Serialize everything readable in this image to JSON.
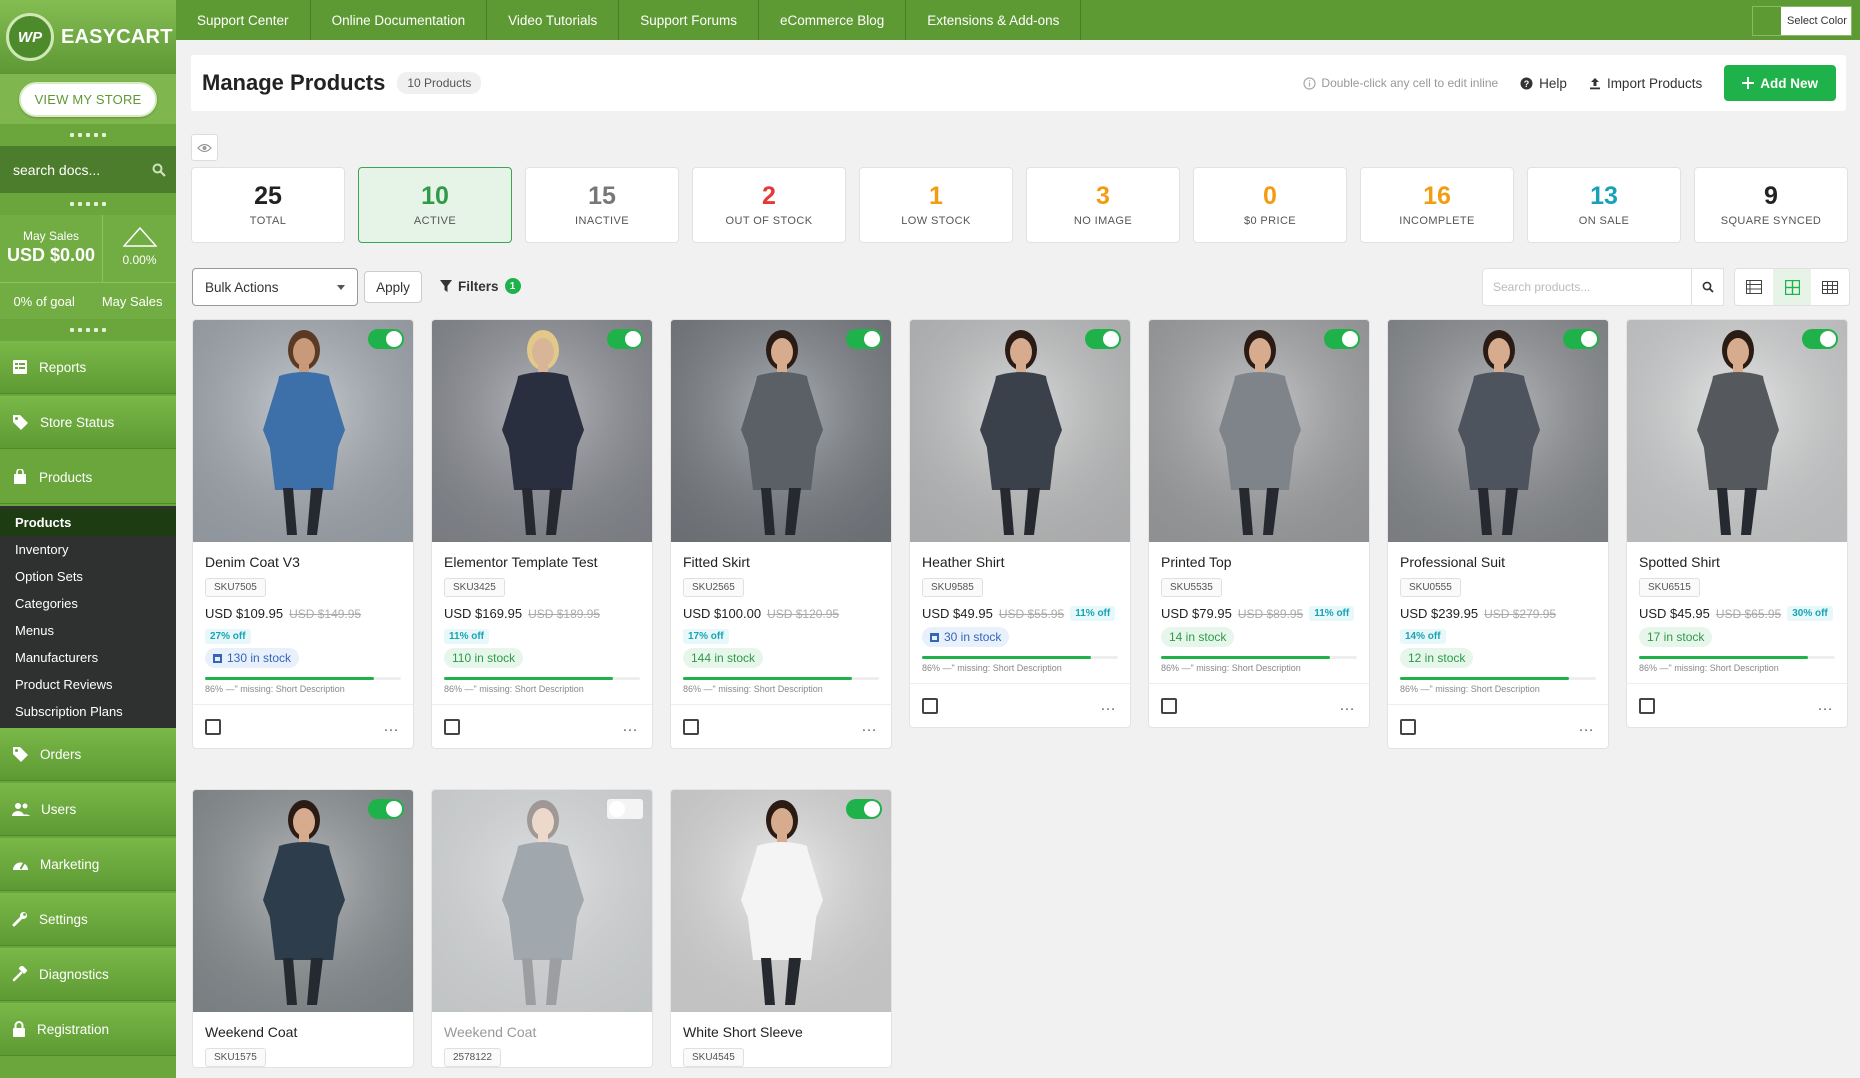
{
  "app": {
    "logo_mark": "WP",
    "name": "EASYCART",
    "view_store": "VIEW MY STORE",
    "search_placeholder": "search docs..."
  },
  "sales": {
    "label": "May Sales",
    "amount": "USD $0.00",
    "change": "0.00%",
    "goal": "0% of goal",
    "period": "May Sales"
  },
  "nav": [
    {
      "label": "Reports",
      "icon": "report-icon"
    },
    {
      "label": "Store Status",
      "icon": "tag-icon"
    },
    {
      "label": "Products",
      "icon": "bag-icon"
    }
  ],
  "sub_nav": [
    "Products",
    "Inventory",
    "Option Sets",
    "Categories",
    "Menus",
    "Manufacturers",
    "Product Reviews",
    "Subscription Plans"
  ],
  "nav2": [
    {
      "label": "Orders",
      "icon": "tag-icon"
    },
    {
      "label": "Users",
      "icon": "users-icon"
    },
    {
      "label": "Marketing",
      "icon": "gauge-icon"
    },
    {
      "label": "Settings",
      "icon": "wrench-icon"
    },
    {
      "label": "Diagnostics",
      "icon": "hammer-icon"
    },
    {
      "label": "Registration",
      "icon": "lock-icon"
    }
  ],
  "topbar": {
    "links": [
      "Support Center",
      "Online Documentation",
      "Video Tutorials",
      "Support Forums",
      "eCommerce Blog",
      "Extensions & Add-ons"
    ],
    "select_color": "Select Color"
  },
  "header": {
    "title": "Manage Products",
    "count": "10 Products",
    "hint": "Double-click any cell to edit inline",
    "help": "Help",
    "import": "Import Products",
    "add": "Add New"
  },
  "stats": [
    {
      "value": "25",
      "label": "TOTAL",
      "color": "#222222"
    },
    {
      "value": "10",
      "label": "ACTIVE",
      "color": "#2e9a4a"
    },
    {
      "value": "15",
      "label": "INACTIVE",
      "color": "#777777"
    },
    {
      "value": "2",
      "label": "OUT OF STOCK",
      "color": "#e53935"
    },
    {
      "value": "1",
      "label": "LOW STOCK",
      "color": "#f39c12"
    },
    {
      "value": "3",
      "label": "NO IMAGE",
      "color": "#f39c12"
    },
    {
      "value": "0",
      "label": "$0 PRICE",
      "color": "#f39c12"
    },
    {
      "value": "16",
      "label": "INCOMPLETE",
      "color": "#f39c12"
    },
    {
      "value": "13",
      "label": "ON SALE",
      "color": "#17a2b8"
    },
    {
      "value": "9",
      "label": "SQUARE SYNCED",
      "color": "#222222"
    }
  ],
  "toolbar": {
    "bulk": "Bulk Actions",
    "apply": "Apply",
    "filters": "Filters",
    "filter_count": "1",
    "search_placeholder": "Search products..."
  },
  "products": [
    {
      "name": "Denim Coat V3",
      "sku": "SKU7505",
      "price": "USD $109.95",
      "was": "USD $149.95",
      "off": "27% off",
      "stock": "130 in stock",
      "stock_style": "blue",
      "missing": "86% —\" missing: Short Description",
      "completeness": 0.86,
      "active": true,
      "bg": "#a9b0b8",
      "cloth": "#3d6fa8",
      "skin": "#c89a7a",
      "hair": "#5a3a24"
    },
    {
      "name": "Elementor Template Test",
      "sku": "SKU3425",
      "price": "USD $169.95",
      "was": "USD $189.95",
      "off": "11% off",
      "stock": "110 in stock",
      "stock_style": "green",
      "missing": "86% —\" missing: Short Description",
      "completeness": 0.86,
      "active": true,
      "bg": "#8e9198",
      "cloth": "#2a2f3f",
      "skin": "#d8b596",
      "hair": "#e2c98a"
    },
    {
      "name": "Fitted Skirt",
      "sku": "SKU2565",
      "price": "USD $100.00",
      "was": "USD $120.95",
      "off": "17% off",
      "stock": "144 in stock",
      "stock_style": "green",
      "missing": "86% —\" missing: Short Description",
      "completeness": 0.86,
      "active": true,
      "bg": "#7d8288",
      "cloth": "#5b5f66",
      "skin": "#d6ab8e",
      "hair": "#2a1c14"
    },
    {
      "name": "Heather Shirt",
      "sku": "SKU9585",
      "price": "USD $49.95",
      "was": "USD $55.95",
      "off": "11% off",
      "stock": "30 in stock",
      "stock_style": "blue",
      "missing": "86% —\" missing: Short Description",
      "completeness": 0.86,
      "active": true,
      "bg": "#c7c8c9",
      "cloth": "#3a414b",
      "skin": "#d6ab8e",
      "hair": "#2a1c14"
    },
    {
      "name": "Printed Top",
      "sku": "SKU5535",
      "price": "USD $79.95",
      "was": "USD $89.95",
      "off": "11% off",
      "stock": "14 in stock",
      "stock_style": "green",
      "missing": "86% —\" missing: Short Description",
      "completeness": 0.86,
      "active": true,
      "bg": "#a8a9ab",
      "cloth": "#7f848a",
      "skin": "#d6ab8e",
      "hair": "#2a1c14"
    },
    {
      "name": "Professional Suit",
      "sku": "SKU0555",
      "price": "USD $239.95",
      "was": "USD $279.95",
      "off": "14% off",
      "stock": "12 in stock",
      "stock_style": "green",
      "missing": "86% —\" missing: Short Description",
      "completeness": 0.86,
      "active": true,
      "bg": "#8f9296",
      "cloth": "#4e545d",
      "skin": "#d6ab8e",
      "hair": "#2a1c14"
    },
    {
      "name": "Spotted Shirt",
      "sku": "SKU6515",
      "price": "USD $45.95",
      "was": "USD $65.95",
      "off": "30% off",
      "stock": "17 in stock",
      "stock_style": "green",
      "missing": "86% —\" missing: Short Description",
      "completeness": 0.86,
      "active": true,
      "bg": "#d9dadb",
      "cloth": "#55585c",
      "skin": "#d6ab8e",
      "hair": "#2a1c14"
    },
    {
      "name": "Weekend Coat",
      "sku": "SKU1575",
      "active": true,
      "bg": "#8f9599",
      "cloth": "#2e3d4b",
      "skin": "#d6ab8e",
      "hair": "#2a1c14"
    },
    {
      "name": "Weekend Coat",
      "sku": "2578122",
      "active": false,
      "bg": "#8f9599",
      "cloth": "#2e3d4b",
      "skin": "#d6ab8e",
      "hair": "#2a1c14"
    },
    {
      "name": "White Short Sleeve",
      "sku": "SKU4545",
      "active": true,
      "bg": "#e4e4e4",
      "cloth": "#f4f4f4",
      "skin": "#d6ab8e",
      "hair": "#2a1c14"
    }
  ]
}
